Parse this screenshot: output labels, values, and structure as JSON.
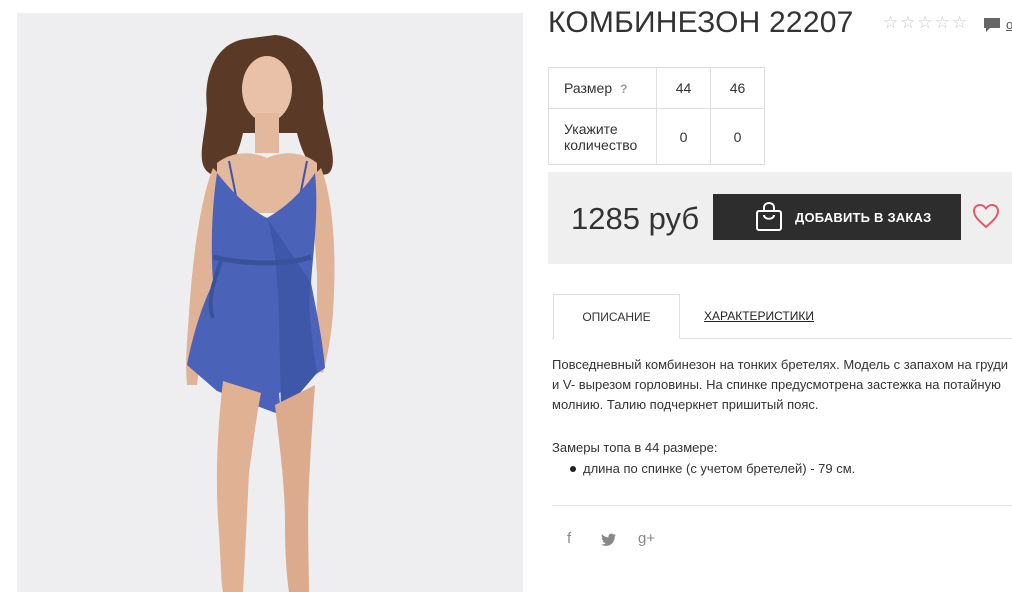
{
  "product": {
    "title": "КОМБИНЕЗОН 22207",
    "rating_stars": [
      "☆",
      "☆",
      "☆",
      "☆",
      "☆"
    ],
    "comments_text": "о"
  },
  "size_table": {
    "size_label": "Размер",
    "help_mark": "?",
    "sizes": [
      "44",
      "46"
    ],
    "qty_label_line1": "Укажите",
    "qty_label_line2": "количество",
    "quantities": [
      "0",
      "0"
    ]
  },
  "purchase": {
    "price": "1285 руб",
    "order_button_label": "ДОБАВИТЬ В ЗАКАЗ"
  },
  "tabs": {
    "description": "ОПИСАНИЕ",
    "characteristics": "ХАРАКТЕРИСТИКИ"
  },
  "description": {
    "line1": "Повседневный комбинезон на тонких бретелях. Модель с запахом на груди",
    "line2": "и V- вырезом горловины. На спинке предусмотрена застежка на потайную",
    "line3": "молнию. Талию подчеркнет пришитый пояс.",
    "measures_title": "Замеры топа в 44 размере:",
    "measures": [
      "длина по спинке (с учетом бретелей) - 79 см."
    ]
  },
  "social": {
    "facebook": "f",
    "twitter": "t",
    "google_plus": "g+"
  },
  "colors": {
    "button_bg": "#2d2d2d",
    "price_box_bg": "#efefef",
    "heart": "#e05a6e",
    "dress": "#4a63b8"
  },
  "icons": {
    "bag": "shopping-bag-icon",
    "heart": "heart-icon",
    "comment": "comment-icon"
  }
}
